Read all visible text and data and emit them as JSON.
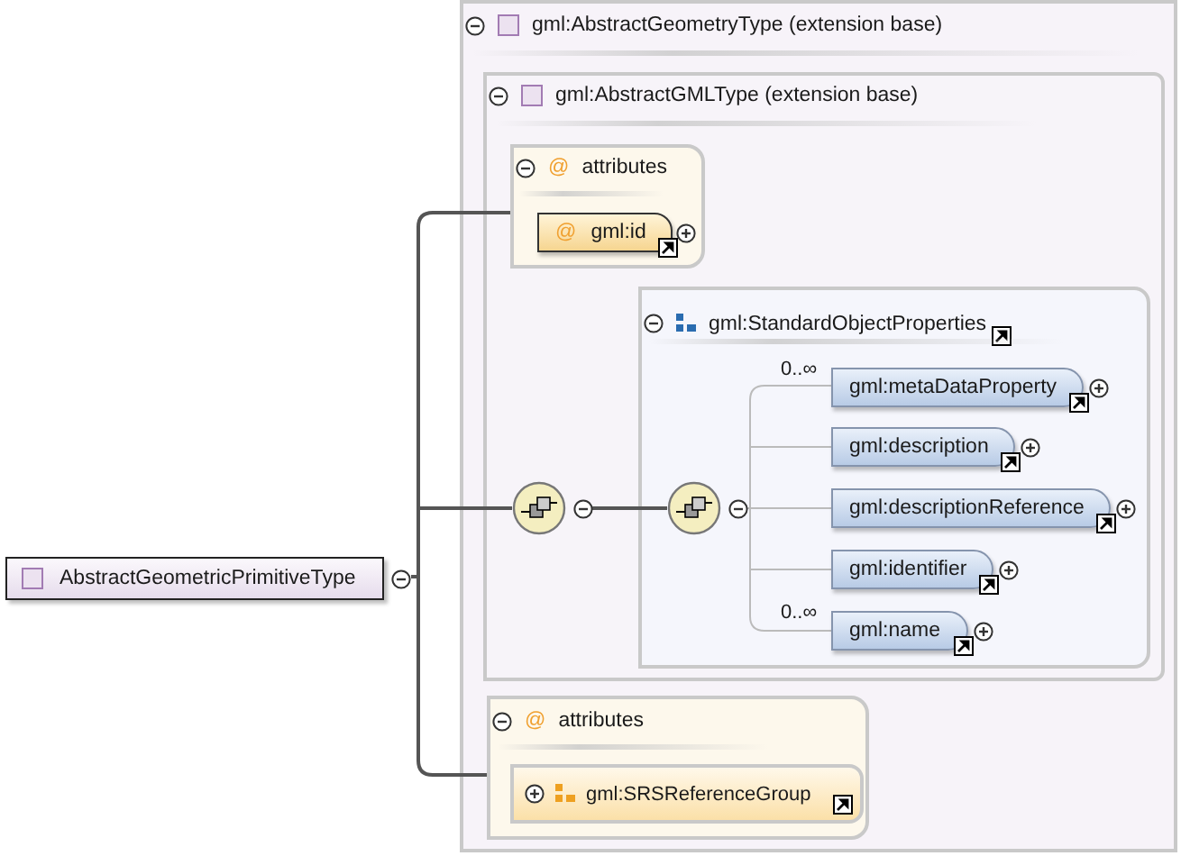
{
  "root": {
    "label": "AbstractGeometricPrimitiveType",
    "expanded": true
  },
  "extension": {
    "label": "gml:AbstractGeometryType (extension base)",
    "expanded": true
  },
  "inner_extension": {
    "label": "gml:AbstractGMLType (extension base)",
    "expanded": true
  },
  "inner_attributes": {
    "symbol": "@",
    "label": "attributes",
    "expanded": true,
    "items": [
      {
        "symbol": "@",
        "label": "gml:id",
        "expanded": false
      }
    ]
  },
  "sequences": [
    {
      "expanded": true
    },
    {
      "expanded": true
    }
  ],
  "group": {
    "label": "gml:StandardObjectProperties",
    "expanded": true,
    "elements": [
      {
        "label": "gml:metaDataProperty",
        "occurs": "0..∞",
        "expanded": false
      },
      {
        "label": "gml:description",
        "expanded": false
      },
      {
        "label": "gml:descriptionReference",
        "expanded": false
      },
      {
        "label": "gml:identifier",
        "expanded": false
      },
      {
        "label": "gml:name",
        "occurs": "0..∞",
        "expanded": false
      }
    ]
  },
  "attributes": {
    "symbol": "@",
    "label": "attributes",
    "expanded": true,
    "items": [
      {
        "label": "gml:SRSReferenceGroup",
        "expanded": false
      }
    ]
  }
}
